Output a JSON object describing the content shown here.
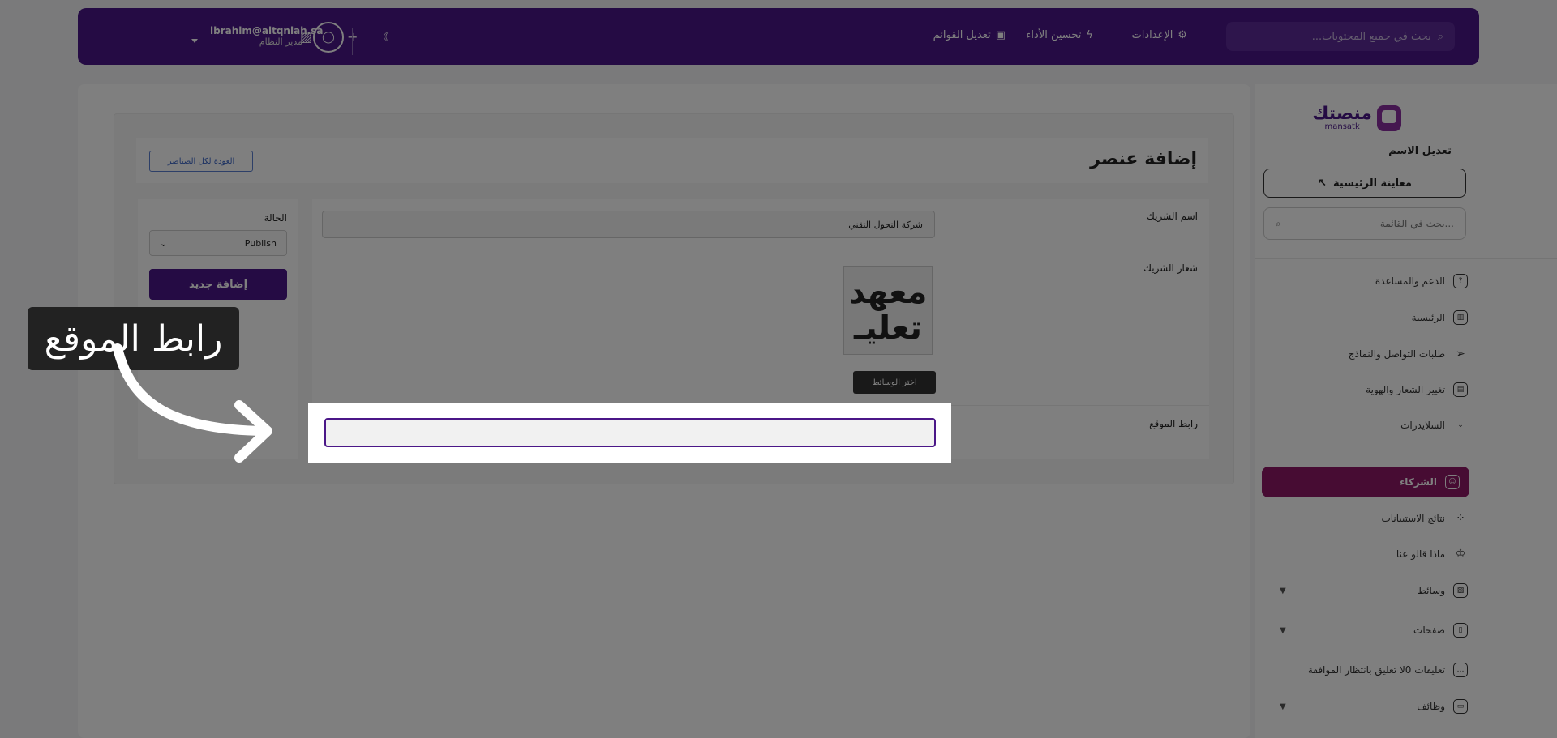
{
  "header": {
    "search_placeholder": "بحث في جميع المحتويات...",
    "links": [
      "الإعدادات",
      "تحسين الأداء",
      "تعديل القوائم"
    ],
    "user_email": "ibrahim@altqniah.sa",
    "user_role": "مدير النظام"
  },
  "sidebar": {
    "brand_ar": "منصتك",
    "brand_en": "mansatk",
    "edit_name": "تعديل الاسم",
    "preview": "معاينة الرئيسية",
    "search_placeholder": "بحث في القائمة...",
    "items": [
      {
        "label": "الدعم والمساعدة"
      },
      {
        "label": "الرئيسية"
      },
      {
        "label": "طلبات التواصل والنماذج"
      },
      {
        "label": "تغيير الشعار والهوية"
      },
      {
        "label": "السلايدرات"
      },
      {
        "label": "الشركاء",
        "active": true
      },
      {
        "label": "نتائج الاستبيانات"
      },
      {
        "label": "ماذا قالو عنا"
      },
      {
        "label": "وسائط"
      },
      {
        "label": "صفحات"
      },
      {
        "label": "تعليقات 0لا تعليق بانتظار الموافقة"
      },
      {
        "label": "وظائف"
      }
    ]
  },
  "page": {
    "title": "إضافة عنصر",
    "back_label": "العودة لكل الصناصر",
    "status_label": "الحالة",
    "status_value": "Publish",
    "add_new": "إضافة جديد",
    "partner_name_label": "اسم الشريك",
    "partner_name_value": "شركة التحول التقني",
    "partner_logo_label": "شعار الشريك",
    "logo_line1": "معهد",
    "logo_line2": "تعليـ",
    "choose_media": "اختر الوسائط",
    "site_url_label": "رابط الموقع",
    "site_url_value": ""
  },
  "overlay": {
    "callout": "رابط الموقع"
  },
  "colors": {
    "primary": "#4b1788",
    "active": "#8e1866"
  }
}
